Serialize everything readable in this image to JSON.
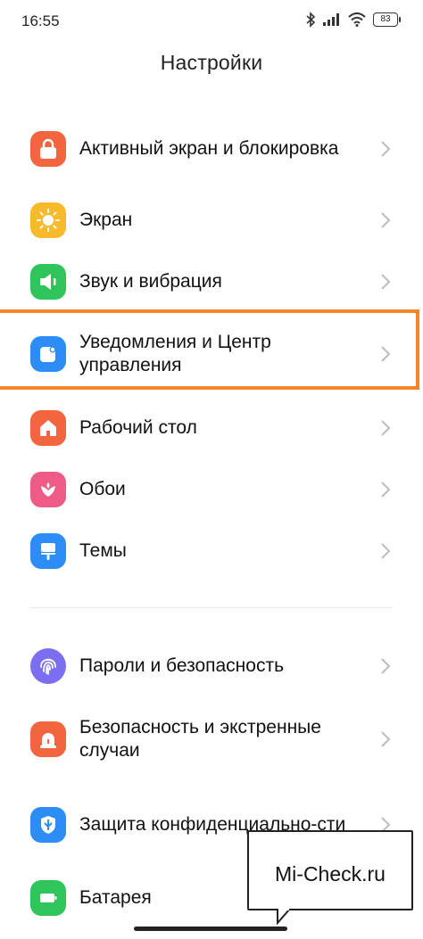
{
  "status_bar": {
    "time": "16:55",
    "battery": "83",
    "icons": [
      "bluetooth-icon",
      "signal-icon",
      "wifi-icon",
      "battery-icon"
    ]
  },
  "header": {
    "title": "Настройки"
  },
  "settings": {
    "group1": [
      {
        "label": "Активный экран и блокировка",
        "icon": "lock-icon",
        "color": "#f3653f"
      },
      {
        "label": "Экран",
        "icon": "sun-icon",
        "color": "#f8b92a"
      },
      {
        "label": "Звук и вибрация",
        "icon": "speaker-icon",
        "color": "#2fc55b"
      },
      {
        "label": "Уведомления и Центр управления",
        "icon": "notification-icon",
        "color": "#2b8df5"
      },
      {
        "label": "Рабочий стол",
        "icon": "home-icon",
        "color": "#f3653f"
      },
      {
        "label": "Обои",
        "icon": "flower-icon",
        "color": "#ef5b87"
      },
      {
        "label": "Темы",
        "icon": "brush-icon",
        "color": "#2b8df5"
      }
    ],
    "group2": [
      {
        "label": "Пароли и безопасность",
        "icon": "fingerprint-icon",
        "color": "#7b6ef0"
      },
      {
        "label": "Безопасность и экстренные случаи",
        "icon": "alarm-icon",
        "color": "#f3653f"
      },
      {
        "label": "Защита конфиденциально-сти",
        "icon": "privacy-shield-icon",
        "color": "#2b8df5"
      },
      {
        "label": "Батарея",
        "icon": "battery-icon",
        "color": "#2fc55b"
      }
    ]
  },
  "highlighted_item": "Уведомления и Центр управления",
  "accent_colors": {
    "highlight": "#f5842b",
    "chevron": "#bdbdbd"
  },
  "watermark": {
    "text": "Mi-Check.ru"
  }
}
